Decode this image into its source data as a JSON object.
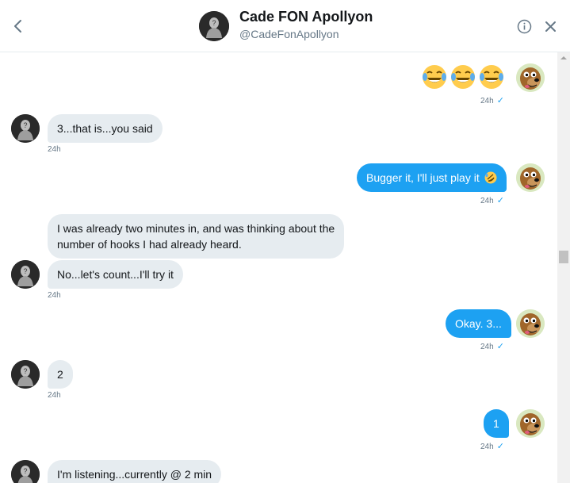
{
  "header": {
    "name": "Cade FON Apollyon",
    "handle": "@CadeFonApollyon"
  },
  "messages": {
    "m1": {
      "time": "24h",
      "check": "✓"
    },
    "m2": {
      "text": "3...that is...you said",
      "time": "24h"
    },
    "m3": {
      "text": "Bugger it, I'll just play it",
      "time": "24h",
      "check": "✓"
    },
    "m4": {
      "text_line1": "I was already two minutes in, and was thinking about the",
      "text_line2": "number of hooks I had already heard."
    },
    "m5": {
      "text": "No...let's count...I'll try it",
      "time": "24h"
    },
    "m6": {
      "text": "Okay. 3...",
      "time": "24h",
      "check": "✓"
    },
    "m7": {
      "text": "2",
      "time": "24h"
    },
    "m8": {
      "text": "1",
      "time": "24h",
      "check": "✓"
    },
    "m9": {
      "text": "I'm listening...currently @ 2 min"
    }
  },
  "colors": {
    "accent": "#1da1f2",
    "incoming_bubble": "#e6ecf0",
    "secondary_text": "#657786"
  },
  "icons": {
    "back": "chevron-left-icon",
    "info": "info-icon",
    "close": "close-icon",
    "laugh_emoji": "tears-of-joy-emoji",
    "rofl_emoji": "rolling-on-floor-laughing-emoji"
  }
}
